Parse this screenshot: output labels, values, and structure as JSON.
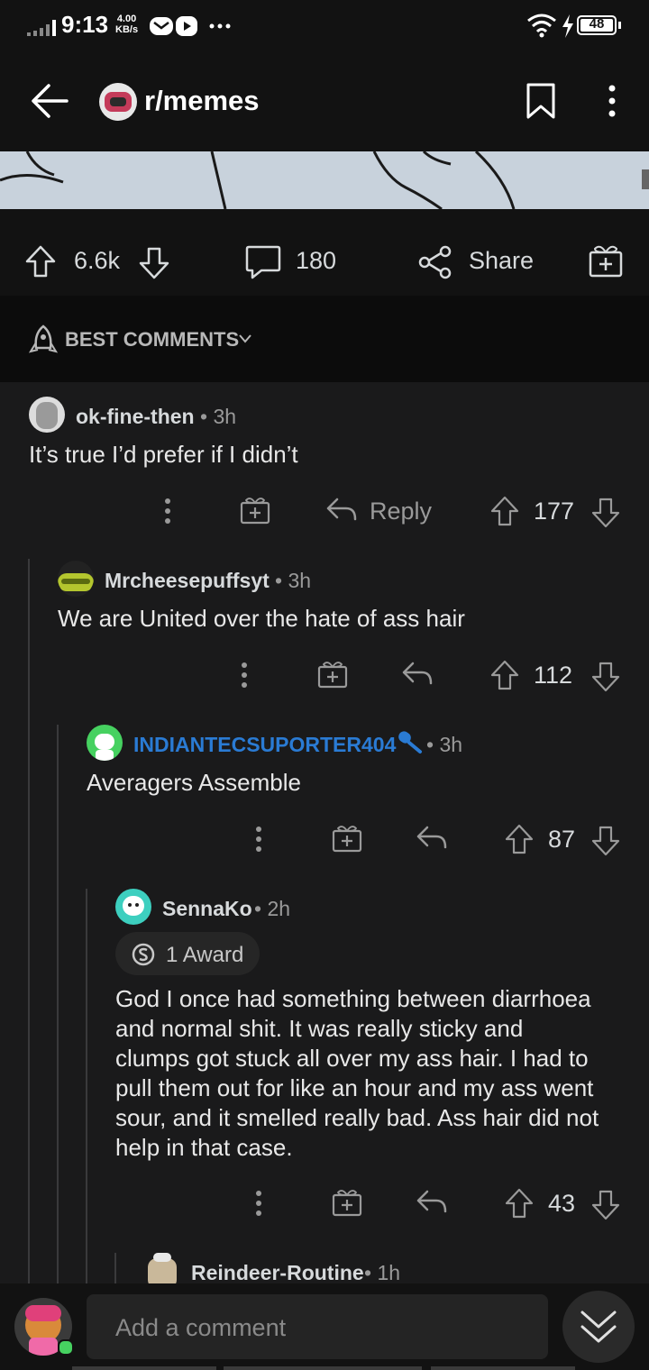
{
  "status_bar": {
    "time": "9:13",
    "speed_value": "4.00",
    "speed_unit": "KB/s",
    "battery": "48",
    "icons": [
      "signal-icon",
      "mail-icon",
      "play-icon",
      "more-icon",
      "wifi-icon",
      "charging-icon",
      "battery-icon"
    ]
  },
  "header": {
    "subreddit": "r/memes",
    "icons": [
      "back-arrow-icon",
      "subreddit-avatar-icon",
      "bookmark-icon",
      "kebab-menu-icon"
    ]
  },
  "post_actions": {
    "upvotes": "6.6k",
    "comments": "180",
    "share_label": "Share"
  },
  "sort": {
    "label": "BEST COMMENTS"
  },
  "comments": [
    {
      "user": "ok-fine-then",
      "age": "3h",
      "body": "It’s true I’d prefer if I didn’t",
      "score": "177",
      "reply_label": "Reply"
    },
    {
      "user": "Mrcheesepuffsyt",
      "age": "3h",
      "body": "We are United over the hate of ass hair",
      "score": "112"
    },
    {
      "user": "INDIANTECSUPORTER404",
      "age": "3h",
      "body": "Averagers Assemble",
      "score": "87",
      "user_color": "#2a7bd4"
    },
    {
      "user": "SennaKo",
      "age": "2h",
      "award": "1 Award",
      "body_lines": [
        "God I once had something between diarrhoea",
        "and normal shit. It was really sticky and",
        "clumps got stuck all over my ass hair. I had to",
        "pull them out for like an hour and my ass went",
        "sour, and it smelled really bad. Ass hair did not",
        "help in that case."
      ],
      "score": "43"
    },
    {
      "user": "Reindeer-Routine",
      "age": "1h"
    }
  ],
  "bottom": {
    "placeholder": "Add a comment"
  },
  "colors": {
    "background": "#121212",
    "comment_bg": "#1a1a1b",
    "text": "#d7dadc",
    "meta": "#9a9a9a",
    "mod_blue": "#2a7bd4",
    "online_green": "#46d160"
  }
}
